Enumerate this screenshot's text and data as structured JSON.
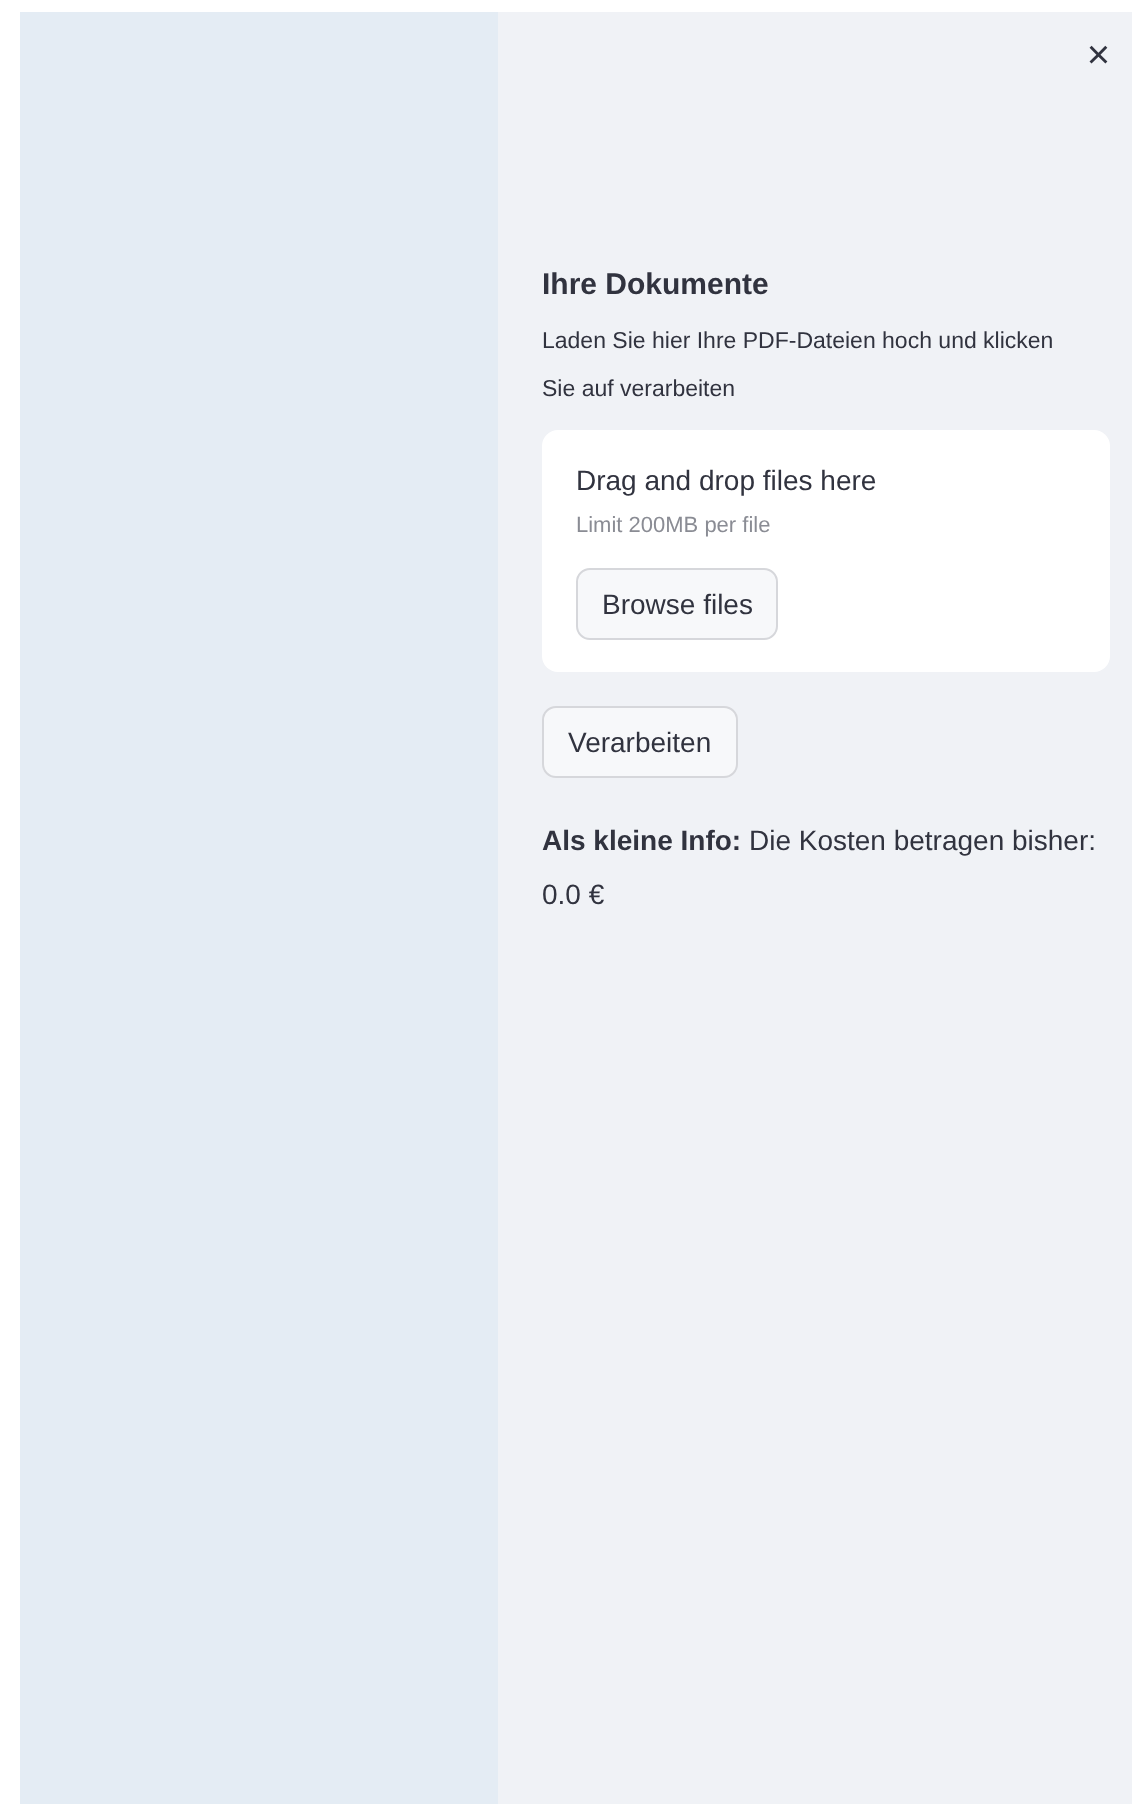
{
  "sidebar": {
    "close_label": "×",
    "heading": "Ihre Dokumente",
    "description": "Laden Sie hier Ihre PDF-Dateien hoch und klicken Sie auf verarbeiten",
    "uploader": {
      "title": "Drag and drop files here",
      "hint": "Limit 200MB per file",
      "button": "Browse files"
    },
    "process_button": "Verarbeiten",
    "info": "**Als kleine Info:** Die Kosten betragen bisher: 0.0 €"
  }
}
